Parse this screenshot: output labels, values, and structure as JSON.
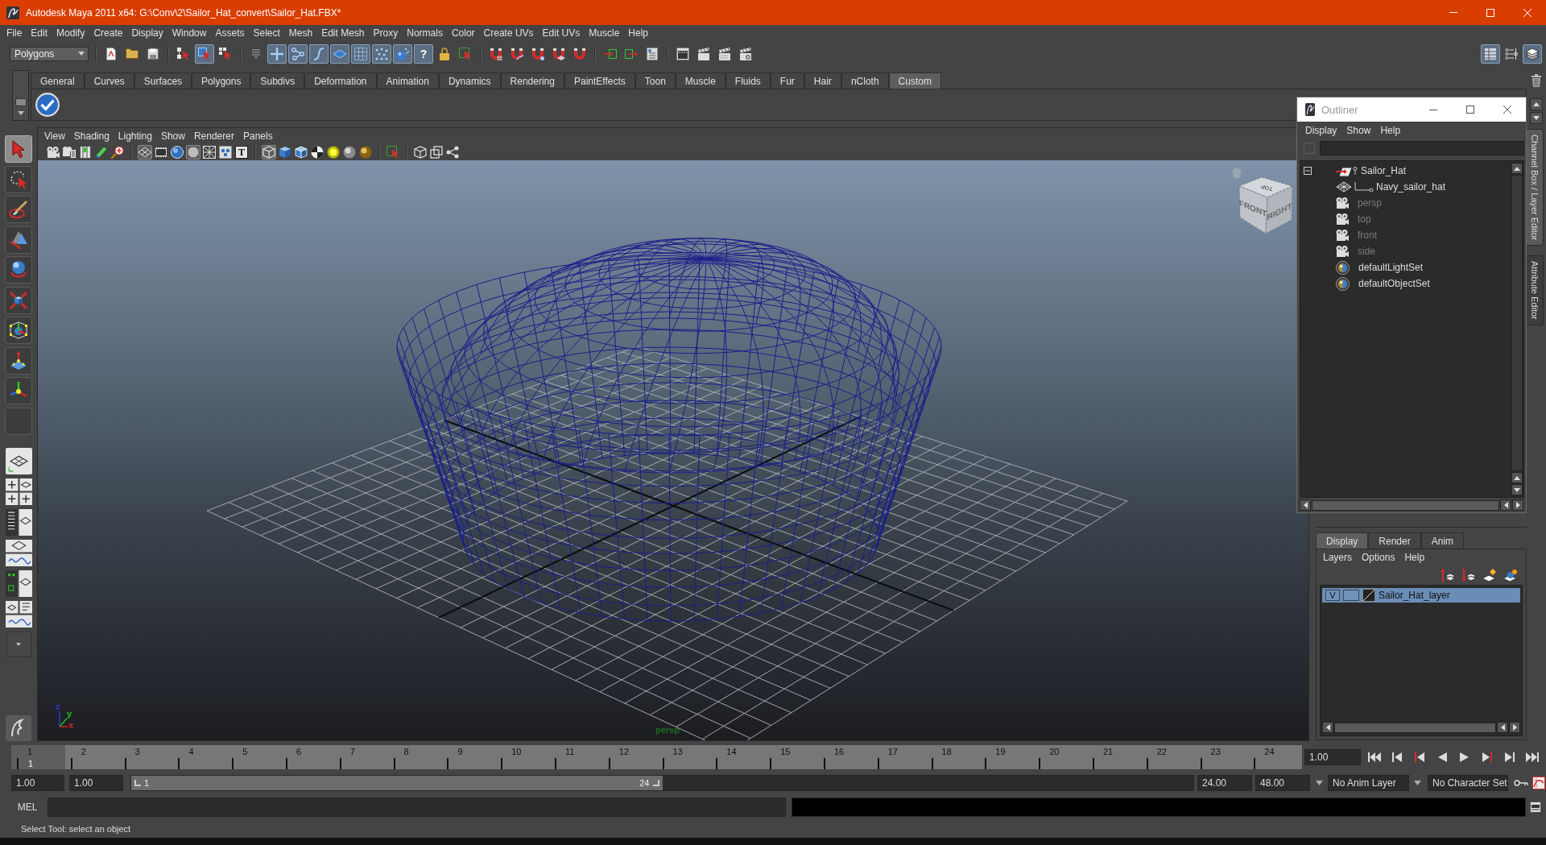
{
  "window": {
    "title": "Autodesk Maya 2011 x64: G:\\Conv\\2\\Sailor_Hat_convert\\Sailor_Hat.FBX*"
  },
  "menu_bar": [
    "File",
    "Edit",
    "Modify",
    "Create",
    "Display",
    "Window",
    "Assets",
    "Select",
    "Mesh",
    "Edit Mesh",
    "Proxy",
    "Normals",
    "Color",
    "Create UVs",
    "Edit UVs",
    "Muscle",
    "Help"
  ],
  "status_line": {
    "menu_set": "Polygons",
    "select_mode_buttons": [
      {
        "on": false
      },
      {
        "on": true
      },
      {
        "on": false
      }
    ],
    "mask_buttons": [
      {
        "on": true
      },
      {
        "on": true
      },
      {
        "on": true
      },
      {
        "on": true
      },
      {
        "on": true
      },
      {
        "on": true
      },
      {
        "on": true
      }
    ],
    "help_button": {
      "label": "?",
      "on": true
    }
  },
  "shelf": {
    "tabs": [
      {
        "label": "General",
        "selected": false
      },
      {
        "label": "Curves",
        "selected": false
      },
      {
        "label": "Surfaces",
        "selected": false
      },
      {
        "label": "Polygons",
        "selected": false
      },
      {
        "label": "Subdivs",
        "selected": false
      },
      {
        "label": "Deformation",
        "selected": false
      },
      {
        "label": "Animation",
        "selected": false
      },
      {
        "label": "Dynamics",
        "selected": false
      },
      {
        "label": "Rendering",
        "selected": false
      },
      {
        "label": "PaintEffects",
        "selected": false
      },
      {
        "label": "Toon",
        "selected": false
      },
      {
        "label": "Muscle",
        "selected": false
      },
      {
        "label": "Fluids",
        "selected": false
      },
      {
        "label": "Fur",
        "selected": false
      },
      {
        "label": "Hair",
        "selected": false
      },
      {
        "label": "nCloth",
        "selected": false
      },
      {
        "label": "Custom",
        "selected": true
      }
    ]
  },
  "toolbox": {
    "tools": [
      {
        "selected": true
      },
      {
        "selected": false
      },
      {
        "selected": false
      },
      {
        "selected": false
      },
      {
        "selected": false
      },
      {
        "selected": false
      },
      {
        "selected": false
      },
      {
        "selected": false
      },
      {
        "selected": false
      }
    ]
  },
  "viewport": {
    "menu": [
      "View",
      "Shading",
      "Lighting",
      "Show",
      "Renderer",
      "Panels"
    ],
    "display_buttons": [
      {
        "on": true
      },
      {
        "on": false
      },
      {
        "on": false
      },
      {
        "on": true
      },
      {
        "on": false
      },
      {
        "on": false
      }
    ],
    "text_button": {
      "label": "T",
      "on": false
    },
    "shading_buttons": [
      {
        "on": true
      },
      {
        "on": false
      },
      {
        "on": false
      },
      {
        "on": false
      },
      {
        "on": false
      },
      {
        "on": false
      },
      {
        "on": false
      }
    ],
    "camera_label": "persp",
    "view_cube": {
      "top": "TOP",
      "front": "FRONT",
      "right": "RIGHT"
    },
    "axes": [
      {
        "label": "z",
        "color": "#2c3cdc"
      },
      {
        "label": "y",
        "color": "#22c022"
      },
      {
        "label": "x",
        "color": "#d82828"
      }
    ]
  },
  "outliner": {
    "title": "Outliner",
    "menu": [
      "Display",
      "Show",
      "Help"
    ],
    "items": [
      {
        "name": "Sailor_Hat",
        "kind": "transform",
        "dimmed": false,
        "expanded": true,
        "children": [
          {
            "name": "Navy_sailor_hat",
            "kind": "mesh",
            "dimmed": false
          }
        ]
      },
      {
        "name": "persp",
        "kind": "camera",
        "dimmed": true
      },
      {
        "name": "top",
        "kind": "camera",
        "dimmed": true
      },
      {
        "name": "front",
        "kind": "camera",
        "dimmed": true
      },
      {
        "name": "side",
        "kind": "camera",
        "dimmed": true
      },
      {
        "name": "defaultLightSet",
        "kind": "set",
        "dimmed": false
      },
      {
        "name": "defaultObjectSet",
        "kind": "set",
        "dimmed": false
      }
    ]
  },
  "side_tabs": [
    {
      "label": "Channel Box / Layer Editor",
      "selected": true
    },
    {
      "label": "Attribute Editor",
      "selected": false
    }
  ],
  "layer_editor": {
    "tabs": [
      {
        "label": "Display",
        "selected": true
      },
      {
        "label": "Render",
        "selected": false
      },
      {
        "label": "Anim",
        "selected": false
      }
    ],
    "menu": [
      "Layers",
      "Options",
      "Help"
    ],
    "layers": [
      {
        "name": "Sailor_Hat_layer",
        "visibility": "V",
        "selected": true
      }
    ]
  },
  "time_slider": {
    "frames": [
      {
        "label": "1",
        "current": true
      },
      {
        "label": "2",
        "current": false
      },
      {
        "label": "3",
        "current": false
      },
      {
        "label": "4",
        "current": false
      },
      {
        "label": "5",
        "current": false
      },
      {
        "label": "6",
        "current": false
      },
      {
        "label": "7",
        "current": false
      },
      {
        "label": "8",
        "current": false
      },
      {
        "label": "9",
        "current": false
      },
      {
        "label": "10",
        "current": false
      },
      {
        "label": "11",
        "current": false
      },
      {
        "label": "12",
        "current": false
      },
      {
        "label": "13",
        "current": false
      },
      {
        "label": "14",
        "current": false
      },
      {
        "label": "15",
        "current": false
      },
      {
        "label": "16",
        "current": false
      },
      {
        "label": "17",
        "current": false
      },
      {
        "label": "18",
        "current": false
      },
      {
        "label": "19",
        "current": false
      },
      {
        "label": "20",
        "current": false
      },
      {
        "label": "21",
        "current": false
      },
      {
        "label": "22",
        "current": false
      },
      {
        "label": "23",
        "current": false
      },
      {
        "label": "24",
        "current": false
      }
    ],
    "current_frame": "1",
    "current_time": "1.00"
  },
  "range_slider": {
    "start_time": "1.00",
    "playback_start": "1.00",
    "range_start": "1",
    "range_end": "24",
    "level": 0.5,
    "playback_end": "24.00",
    "end_time": "48.00",
    "anim_layer": "No Anim Layer",
    "character_set": "No Character Set"
  },
  "command_line": {
    "language": "MEL"
  },
  "help_line": "Select Tool: select an object"
}
